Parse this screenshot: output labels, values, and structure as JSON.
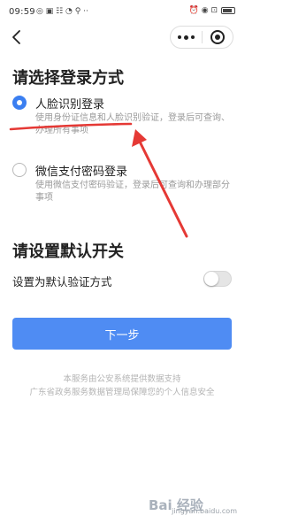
{
  "status_bar": {
    "time": "09:59",
    "left_icons": "◎ ▣ ☷ ◔ ⚲ ··",
    "right_icons": "⏰ ◉ ⊡"
  },
  "nav": {
    "back_icon": "chevron-left",
    "menu_icon": "more-dots",
    "close_icon": "target-circle"
  },
  "login_section": {
    "title": "请选择登录方式",
    "options": [
      {
        "title": "人脸识别登录",
        "desc": "使用身份证信息和人脸识别验证，登录后可查询、办理所有事项",
        "selected": true
      },
      {
        "title": "微信支付密码登录",
        "desc": "使用微信支付密码验证，登录后可查询和办理部分事项",
        "selected": false
      }
    ]
  },
  "default_section": {
    "title": "请设置默认开关",
    "setting_label": "设置为默认验证方式",
    "toggle_on": false
  },
  "next_button": "下一步",
  "footer": {
    "line1": "本服务由公安系统提供数据支持",
    "line2": "广东省政务服务数据管理局保障您的个人信息安全"
  },
  "watermark": {
    "logo": "Bai 经验",
    "text": "jingyan.baidu.com"
  },
  "colors": {
    "accent": "#4f8cf3",
    "radio_checked": "#3b7ff1",
    "annotation": "#e53935"
  }
}
